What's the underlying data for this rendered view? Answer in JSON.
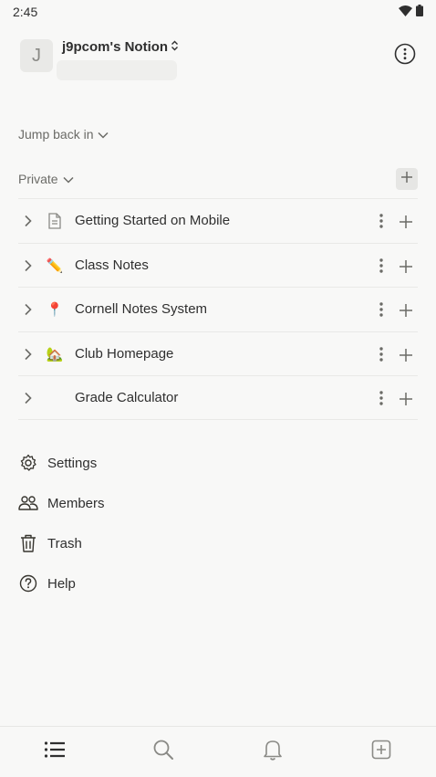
{
  "status_bar": {
    "time": "2:45"
  },
  "workspace": {
    "avatar_letter": "J",
    "name": "j9pcom's Notion"
  },
  "sections": {
    "jump_back": "Jump back in",
    "private": "Private"
  },
  "pages": [
    {
      "title": "Getting Started on Mobile",
      "icon": "page-icon"
    },
    {
      "title": "Class Notes",
      "icon": "pencil-emoji",
      "emoji": "✏️"
    },
    {
      "title": "Cornell Notes System",
      "icon": "pushpin-emoji",
      "emoji": "📍"
    },
    {
      "title": "Club Homepage",
      "icon": "house-emoji",
      "emoji": "🏡"
    },
    {
      "title": "Grade Calculator",
      "icon": "none"
    }
  ],
  "menu": {
    "settings": "Settings",
    "members": "Members",
    "trash": "Trash",
    "help": "Help"
  },
  "tabs": [
    "list-icon",
    "search-icon",
    "bell-icon",
    "new-page-icon"
  ],
  "colors": {
    "background": "#f8f8f7",
    "text": "#2f2f2f",
    "muted": "#6b6b67",
    "divider": "#e9e9e7"
  }
}
